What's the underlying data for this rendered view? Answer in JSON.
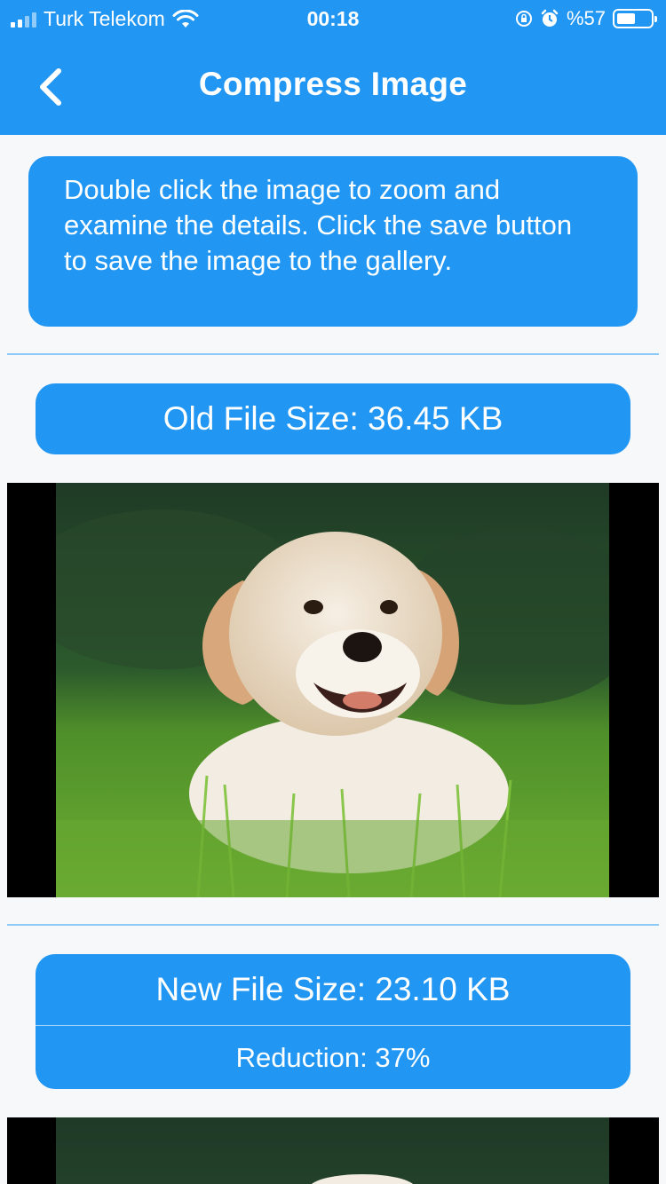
{
  "status_bar": {
    "carrier": "Turk Telekom",
    "time": "00:18",
    "battery": "%57",
    "battery_level": 0.57,
    "icons": [
      "signal-icon",
      "wifi-icon",
      "orientation-lock-icon",
      "alarm-icon",
      "battery-icon"
    ]
  },
  "nav": {
    "title": "Compress Image",
    "back_icon": "chevron-left-icon"
  },
  "info": {
    "text": "Double click the image to zoom and examine the details. Click the save button to save the image to the gallery."
  },
  "original": {
    "label": "Old File Size: 36.45 KB"
  },
  "compressed": {
    "label": "New File Size: 23.10 KB",
    "reduction": "Reduction: 37%"
  },
  "colors": {
    "accent": "#2196f3",
    "background": "#f7f8fa",
    "divider": "#8cc9f7",
    "letterbox": "#000000"
  }
}
